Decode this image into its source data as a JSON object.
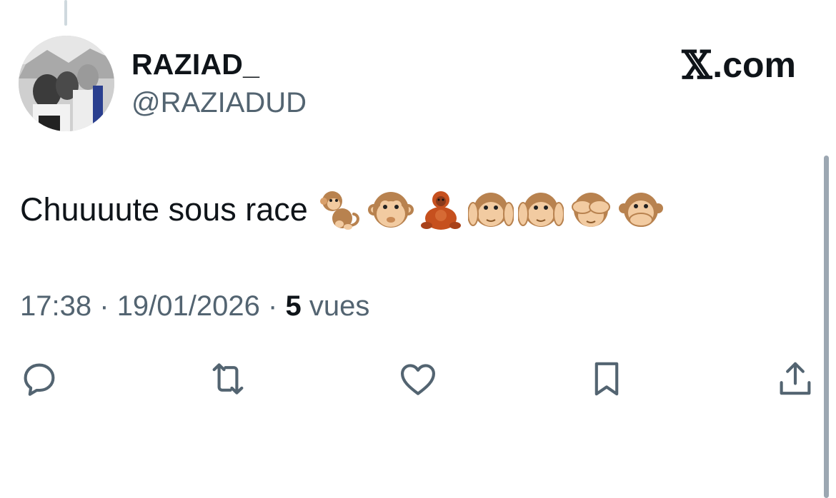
{
  "tweet": {
    "display_name": "RAZIAD_",
    "handle": "@RAZIADUD",
    "text": "Chuuuute sous race",
    "emojis": [
      "monkey",
      "monkey-face",
      "orangutan",
      "hear-no-evil",
      "hear-no-evil",
      "see-no-evil",
      "speak-no-evil"
    ],
    "time": "17:38",
    "date": "19/01/2026",
    "separator": "·",
    "views_count": "5",
    "views_label": "vues"
  },
  "brand": {
    "x_glyph": "𝕏",
    "domain": ".com"
  },
  "actions": [
    {
      "name": "reply",
      "icon": "reply-icon"
    },
    {
      "name": "retweet",
      "icon": "retweet-icon"
    },
    {
      "name": "like",
      "icon": "heart-icon"
    },
    {
      "name": "bookmark",
      "icon": "bookmark-icon"
    },
    {
      "name": "share",
      "icon": "share-icon"
    }
  ],
  "colors": {
    "text_primary": "#0f1419",
    "text_secondary": "#536471",
    "icon": "#536471",
    "thread_line": "#cfd9de",
    "monkey_fur": "#b8824f",
    "monkey_face": "#f2cba1",
    "orangutan": "#c6501e"
  }
}
